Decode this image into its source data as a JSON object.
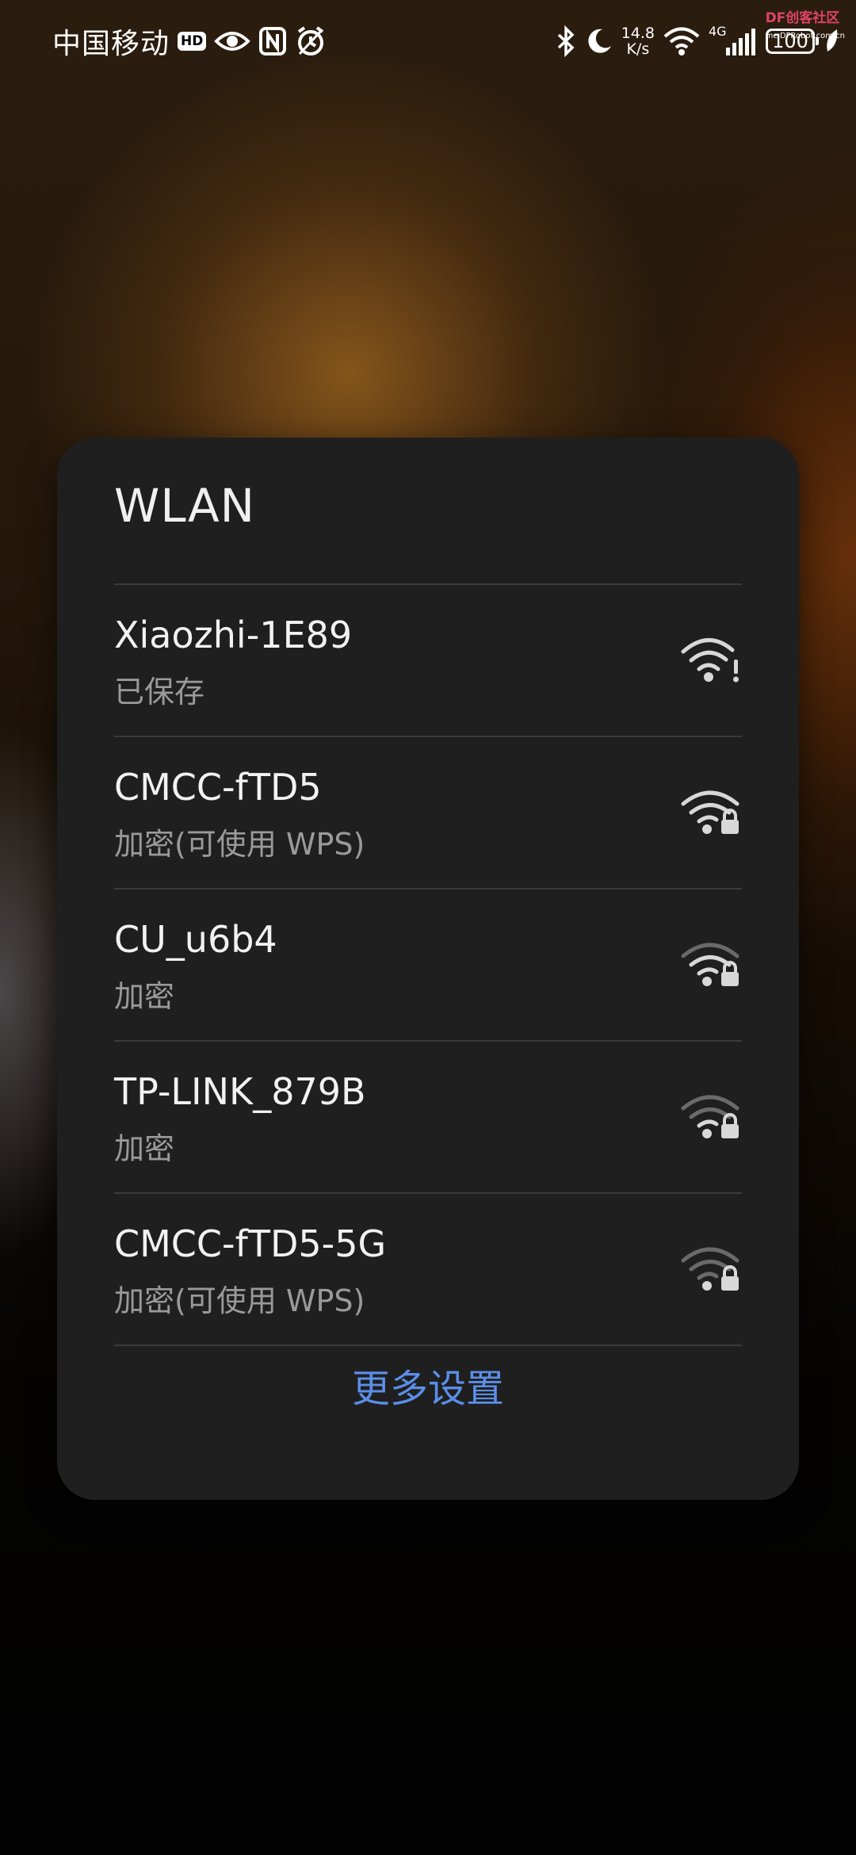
{
  "status_bar": {
    "carrier": "中国移动",
    "hd_label": "HD",
    "speed_value": "14.8",
    "speed_unit": "K/s",
    "network_type": "4G",
    "battery_level": "100",
    "icons": [
      "eye-icon",
      "nfc-icon",
      "alarm-icon",
      "bluetooth-icon",
      "moon-icon",
      "wifi-icon",
      "signal-icon",
      "battery-icon",
      "leaf-icon"
    ]
  },
  "watermark": {
    "brand": "DF创客社区",
    "site": "mc.DFRobot.com.cn"
  },
  "wlan_dialog": {
    "title": "WLAN",
    "networks": [
      {
        "name": "Xiaozhi-1E89",
        "status": "已保存",
        "icon": "wifi-warning-icon"
      },
      {
        "name": "CMCC-fTD5",
        "status": "加密(可使用 WPS)",
        "icon": "wifi-lock-icon"
      },
      {
        "name": "CU_u6b4",
        "status": "加密",
        "icon": "wifi-lock-icon"
      },
      {
        "name": "TP-LINK_879B",
        "status": "加密",
        "icon": "wifi-lock-icon"
      },
      {
        "name": "CMCC-fTD5-5G",
        "status": "加密(可使用 WPS)",
        "icon": "wifi-lock-icon"
      }
    ],
    "more_settings_label": "更多设置",
    "accent_color": "#5b8fe8"
  }
}
